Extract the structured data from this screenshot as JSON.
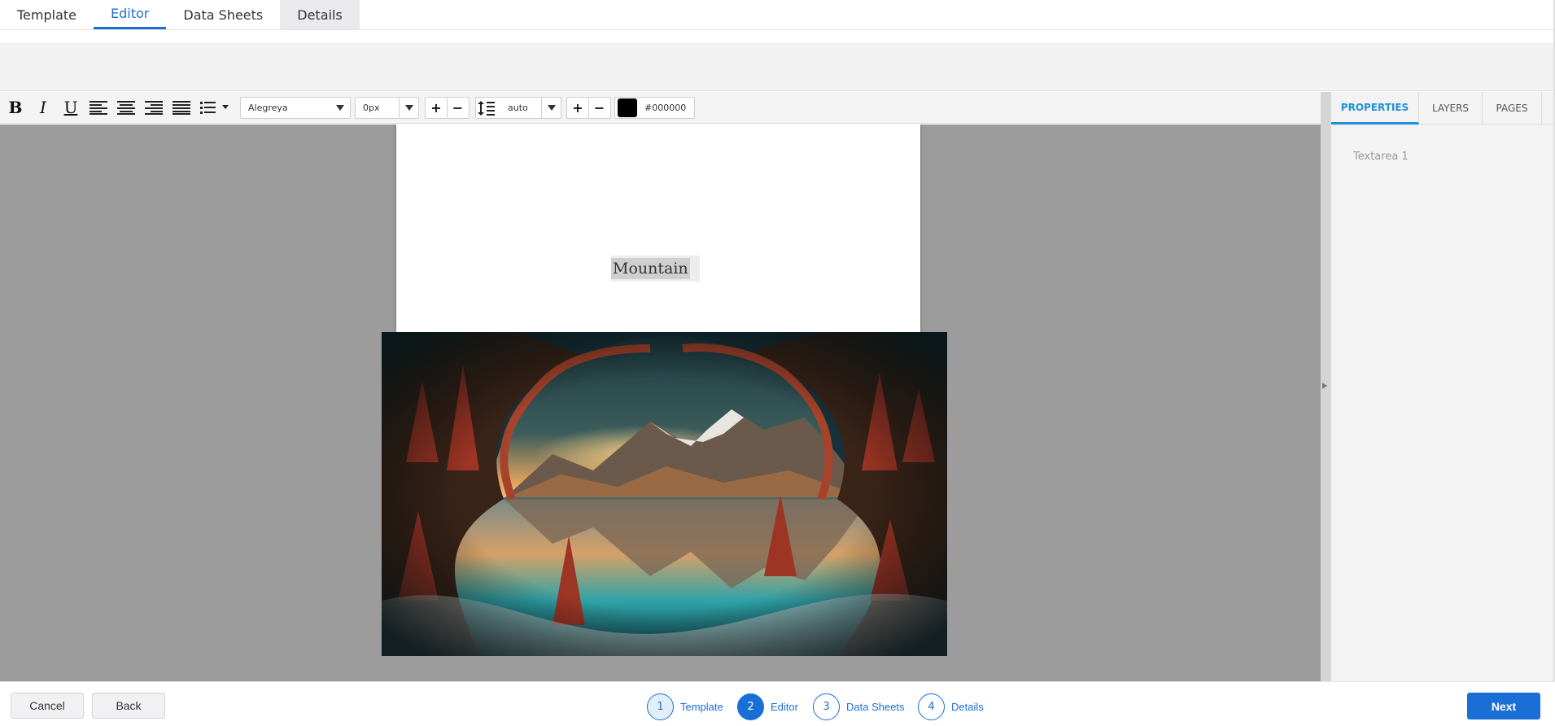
{
  "top_tabs": [
    {
      "label": "Template"
    },
    {
      "label": "Editor"
    },
    {
      "label": "Data Sheets"
    },
    {
      "label": "Details"
    }
  ],
  "toolbar": {
    "font_family": "Alegreya",
    "letter_spacing": "0px",
    "line_height": "auto",
    "color_hex": "#000000",
    "color_value": "#000000"
  },
  "canvas": {
    "text_content": "Mountain"
  },
  "sidebar": {
    "tabs": [
      {
        "label": "PROPERTIES"
      },
      {
        "label": "LAYERS"
      },
      {
        "label": "PAGES"
      }
    ],
    "selected_layer": "Textarea 1"
  },
  "footer": {
    "cancel_label": "Cancel",
    "back_label": "Back",
    "next_label": "Next",
    "steps": [
      {
        "number": "1",
        "label": "Template"
      },
      {
        "number": "2",
        "label": "Editor"
      },
      {
        "number": "3",
        "label": "Data Sheets"
      },
      {
        "number": "4",
        "label": "Details"
      }
    ]
  },
  "colors": {
    "accent": "#1a6fd6",
    "canvas_bg": "#9c9c9c",
    "sidebar_accent": "#1e90d6"
  }
}
